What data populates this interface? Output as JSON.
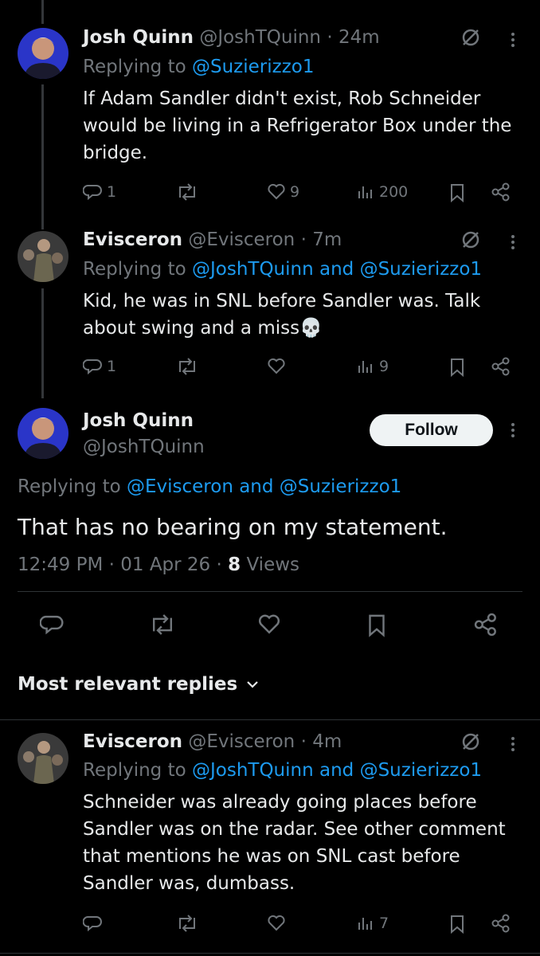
{
  "tweets": [
    {
      "name": "Josh Quinn",
      "handle": "@JoshTQuinn",
      "time": "· 24m",
      "replying_prefix": "Replying to ",
      "replying_to": "@Suzierizzo1",
      "text": "If Adam Sandler didn't exist, Rob Schneider would be living in a Refrigerator Box under the bridge.",
      "replies": "1",
      "likes": "9",
      "views": "200"
    },
    {
      "name": "Evisceron",
      "handle": "@Evisceron",
      "time": "· 7m",
      "replying_prefix": "Replying to ",
      "replying_to": "@JoshTQuinn and @Suzierizzo1",
      "text": "Kid, he was in SNL before Sandler was. Talk about swing and a miss💀",
      "replies": "1",
      "likes": "",
      "views": "9"
    }
  ],
  "main_tweet": {
    "name": "Josh Quinn",
    "handle": "@JoshTQuinn",
    "follow_label": "Follow",
    "replying_prefix": "Replying to ",
    "replying_to": "@Evisceron and @Suzierizzo1",
    "text": "That has no bearing on my statement.",
    "timestamp": "12:49 PM · 01 Apr 26 · ",
    "views_count": "8",
    "views_label": " Views"
  },
  "replies_section": {
    "title": "Most relevant replies"
  },
  "reply": {
    "name": "Evisceron",
    "handle": "@Evisceron",
    "time": "· 4m",
    "replying_prefix": "Replying to ",
    "replying_to": "@JoshTQuinn and @Suzierizzo1",
    "text": "Schneider was already going places before Sandler was on the radar. See other comment that mentions he was on SNL cast before Sandler was, dumbass.",
    "views": "7"
  },
  "colors": {
    "background": "#000000",
    "text": "#e7e9ea",
    "secondary": "#71767b",
    "link": "#1d9bf0",
    "follow_bg": "#eff3f4"
  }
}
